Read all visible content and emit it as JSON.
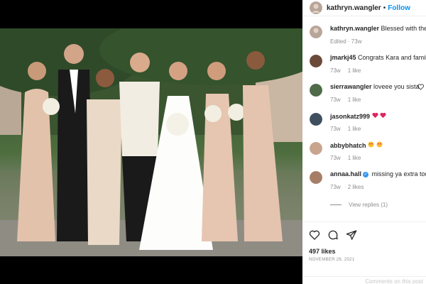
{
  "post": {
    "username": "kathryn.wangler",
    "follow_label": "Follow",
    "separator": "•"
  },
  "caption": {
    "username": "kathryn.wangler",
    "text": "Blessed with the",
    "meta": "Edited · 73w"
  },
  "comments": [
    {
      "username": "jmarkj45",
      "text": "Congrats Kara and family",
      "age": "73w",
      "likes": "1 like",
      "verified": false
    },
    {
      "username": "sierrawangler",
      "text": "loveee you sista",
      "age": "73w",
      "likes": "1 like",
      "verified": false
    },
    {
      "username": "jasonkatz999",
      "text": "",
      "age": "73w",
      "likes": "1 like",
      "verified": false
    },
    {
      "username": "abbybhatch",
      "text": "",
      "age": "73w",
      "likes": "1 like",
      "verified": false
    },
    {
      "username": "annaa.hall",
      "text": "missing ya extra toda",
      "age": "73w",
      "likes": "2 likes",
      "verified": true
    }
  ],
  "view_replies": "View replies (1)",
  "likes_count": "497 likes",
  "date": "NOVEMBER 26, 2021",
  "add_comment_placeholder": "Comments on this post",
  "colors": {
    "link": "#0095f6",
    "text": "#262626",
    "muted": "#8e8e8e"
  },
  "icons": [
    "heart-icon",
    "comment-icon",
    "share-icon"
  ]
}
